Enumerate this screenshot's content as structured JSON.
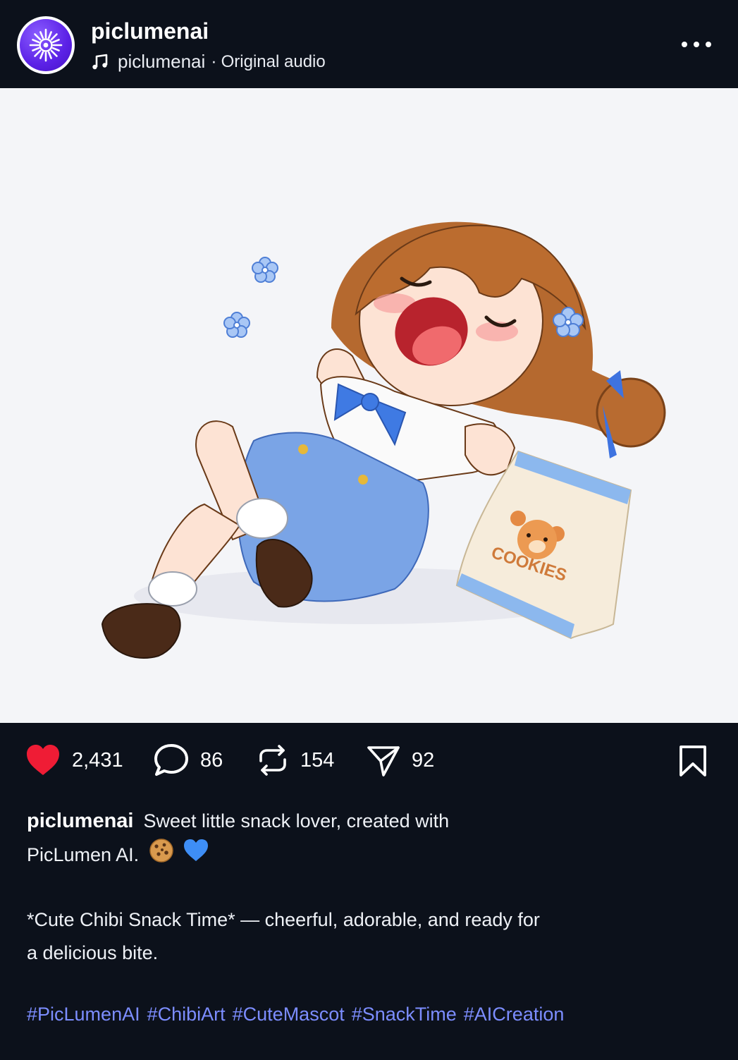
{
  "post": {
    "username": "piclumenai",
    "audio_account": "piclumenai",
    "audio_separator": "·",
    "audio_label": "Original audio"
  },
  "image": {
    "bag_text": "COOKIES"
  },
  "actions": {
    "likes": "2,431",
    "comments": "86",
    "reposts": "154",
    "shares": "92"
  },
  "caption": {
    "username": "piclumenai",
    "text": "Sweet little snack lover, created with PicLumen AI.",
    "description": "*Cute Chibi Snack Time* — cheerful, adorable, and ready for a delicious bite.",
    "hashtags": [
      "#PicLumenAI",
      "#ChibiArt",
      "#CuteMascot",
      "#SnackTime",
      "#AICreation"
    ]
  },
  "colors": {
    "background": "#0c111b",
    "like": "#ef1c35",
    "hashtag": "#7c8dff",
    "avatar": "#5b21e6"
  },
  "icons": [
    "avatar-logo",
    "music-note-icon",
    "more-icon",
    "heart-icon",
    "comment-icon",
    "repost-icon",
    "send-icon",
    "bookmark-icon",
    "cookie-emoji",
    "blue-heart-emoji"
  ]
}
